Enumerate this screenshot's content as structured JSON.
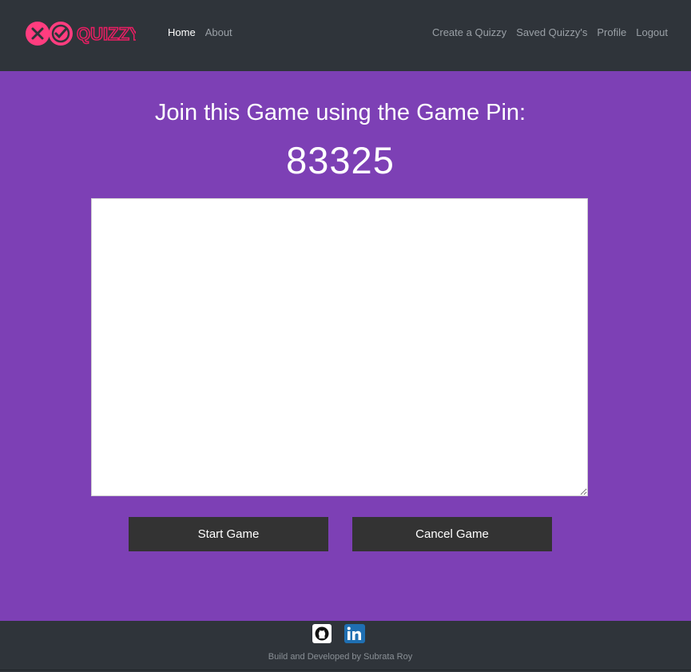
{
  "brand": {
    "name": "QUIZZY",
    "colors": {
      "accent": "#ff3d7f",
      "text": "#c2185b"
    }
  },
  "nav": {
    "left": [
      {
        "label": "Home",
        "active": true
      },
      {
        "label": "About",
        "active": false
      }
    ],
    "right": [
      {
        "label": "Create a Quizzy"
      },
      {
        "label": "Saved Quizzy's"
      },
      {
        "label": "Profile"
      },
      {
        "label": "Logout"
      }
    ]
  },
  "main": {
    "heading": "Join this Game using the Game Pin:",
    "pin": "83325",
    "players_box": {
      "value": "",
      "placeholder": ""
    },
    "buttons": {
      "start": "Start Game",
      "cancel": "Cancel Game"
    },
    "background_color": "#7d40b5"
  },
  "footer": {
    "icons": [
      "github-icon",
      "linkedin-icon"
    ],
    "credit": "Build and Developed by Subrata Roy"
  }
}
